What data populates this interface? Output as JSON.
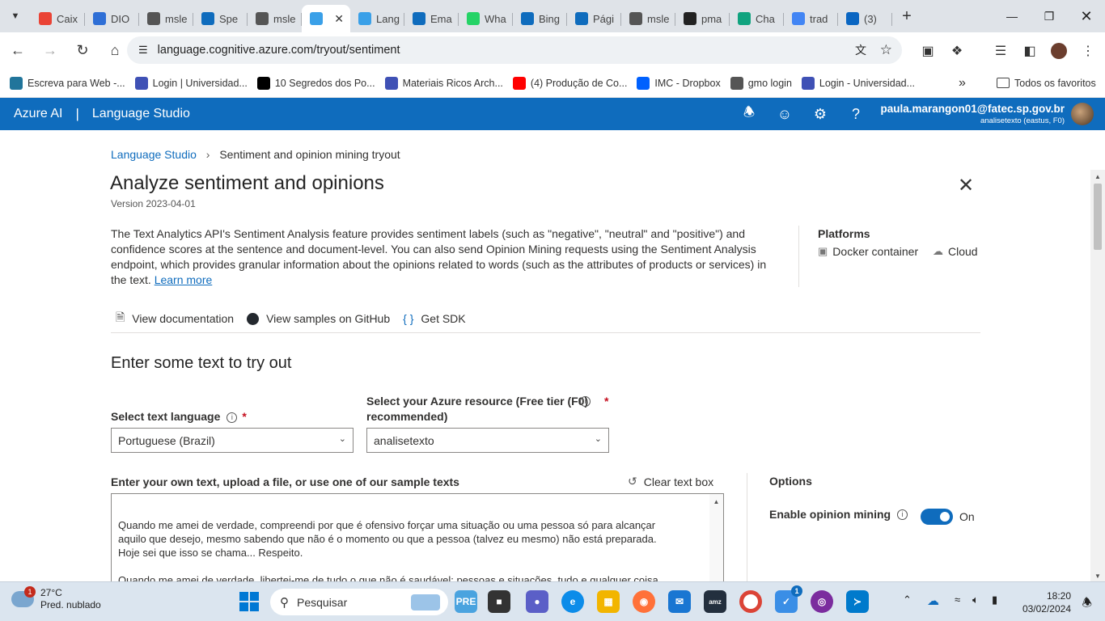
{
  "browser": {
    "tabs": [
      {
        "label": "Caix",
        "icon": "gmail-icon",
        "color": "#ea4335"
      },
      {
        "label": "DIO",
        "icon": "dio-icon",
        "color": "#2f6fd6"
      },
      {
        "label": "msle",
        "icon": "globe-icon",
        "color": "#555555"
      },
      {
        "label": "Spe",
        "icon": "azure-icon",
        "color": "#0f6cbd"
      },
      {
        "label": "msle",
        "icon": "globe-icon",
        "color": "#555555"
      },
      {
        "label": "",
        "icon": "language-studio-icon",
        "color": "#3aa0e8",
        "active": true
      },
      {
        "label": "Lang",
        "icon": "language-studio-icon",
        "color": "#3aa0e8"
      },
      {
        "label": "Ema",
        "icon": "outlook-icon",
        "color": "#0f6cbd"
      },
      {
        "label": "Wha",
        "icon": "whatsapp-icon",
        "color": "#25d366"
      },
      {
        "label": "Bing",
        "icon": "bing-search-icon",
        "color": "#0f6cbd"
      },
      {
        "label": "Pági",
        "icon": "azure-icon",
        "color": "#0f6cbd"
      },
      {
        "label": "msle",
        "icon": "globe-icon",
        "color": "#555555"
      },
      {
        "label": "pma",
        "icon": "github-icon",
        "color": "#222222"
      },
      {
        "label": "Cha",
        "icon": "chatgpt-icon",
        "color": "#10a37f"
      },
      {
        "label": "trad",
        "icon": "google-icon",
        "color": "#4285f4"
      },
      {
        "label": "(3)",
        "icon": "linkedin-icon",
        "color": "#0a66c2"
      }
    ],
    "url": "language.cognitive.azure.com/tryout/sentiment",
    "bookmarks": [
      {
        "label": "Escreva para Web -...",
        "icon": "wordpress-icon"
      },
      {
        "label": "Login | Universidad...",
        "icon": "page-icon"
      },
      {
        "label": "10 Segredos dos Po...",
        "icon": "wix-icon"
      },
      {
        "label": "Materiais Ricos Arch...",
        "icon": "page-icon"
      },
      {
        "label": "(4) Produção de Co...",
        "icon": "youtube-icon"
      },
      {
        "label": "IMC - Dropbox",
        "icon": "dropbox-icon"
      },
      {
        "label": "gmo login",
        "icon": "gmo-icon"
      },
      {
        "label": "Login - Universidad...",
        "icon": "page-icon"
      }
    ],
    "all_bookmarks": "Todos os favoritos"
  },
  "app": {
    "brand": "Azure AI",
    "separator": "|",
    "product": "Language Studio",
    "user_email": "paula.marangon01@fatec.sp.gov.br",
    "user_resource": "analisetexto (eastus, F0)"
  },
  "page": {
    "breadcrumb_root": "Language Studio",
    "breadcrumb_current": "Sentiment and opinion mining tryout",
    "title": "Analyze sentiment and opinions",
    "version": "Version 2023-04-01",
    "description": "The Text Analytics API's Sentiment Analysis feature provides sentiment labels (such as \"negative\", \"neutral\" and \"positive\") and confidence scores at the sentence and document-level. You can also send Opinion Mining requests using the Sentiment Analysis endpoint, which provides granular information about the opinions related to words (such as the attributes of products or services) in the text.",
    "learn_more": "Learn more",
    "platforms_title": "Platforms",
    "platforms": [
      "Docker container",
      "Cloud"
    ],
    "links": [
      "View documentation",
      "View samples on GitHub",
      "Get SDK"
    ],
    "tryout_heading": "Enter some text to try out",
    "language_label": "Select text language",
    "language_value": "Portuguese (Brazil)",
    "resource_label_line1": "Select your Azure resource (Free tier (F0)",
    "resource_label_line2": "recommended)",
    "resource_value": "analisetexto",
    "text_label": "Enter your own text, upload a file, or use one of our sample texts",
    "clear_label": "Clear text box",
    "text_content": "Quando me amei de verdade, compreendi por que é ofensivo forçar uma situação ou uma pessoa só para alcançar\naquilo que desejo, mesmo sabendo que não é o momento ou que a pessoa (talvez eu mesmo) não está preparada.\nHoje sei que isso se chama... Respeito.\n\nQuando me amei de verdade, libertei-me de tudo o que não é saudável: pessoas e situações, tudo e qualquer coisa\nque me empurrasse para baixo. No início a minha razão chamou a essa atitude de egoísmo. Hoje sei que isso se\nchama... Amor por si mesmo.",
    "options_title": "Options",
    "opinion_mining_label": "Enable opinion mining",
    "opinion_mining_state": "On",
    "required_mark": "*"
  },
  "taskbar": {
    "weather_badge": "1",
    "temperature": "27°C",
    "weather_desc": "Pred. nublado",
    "search_placeholder": "Pesquisar",
    "time": "18:20",
    "date": "03/02/2024",
    "vscode_badge": "1"
  }
}
